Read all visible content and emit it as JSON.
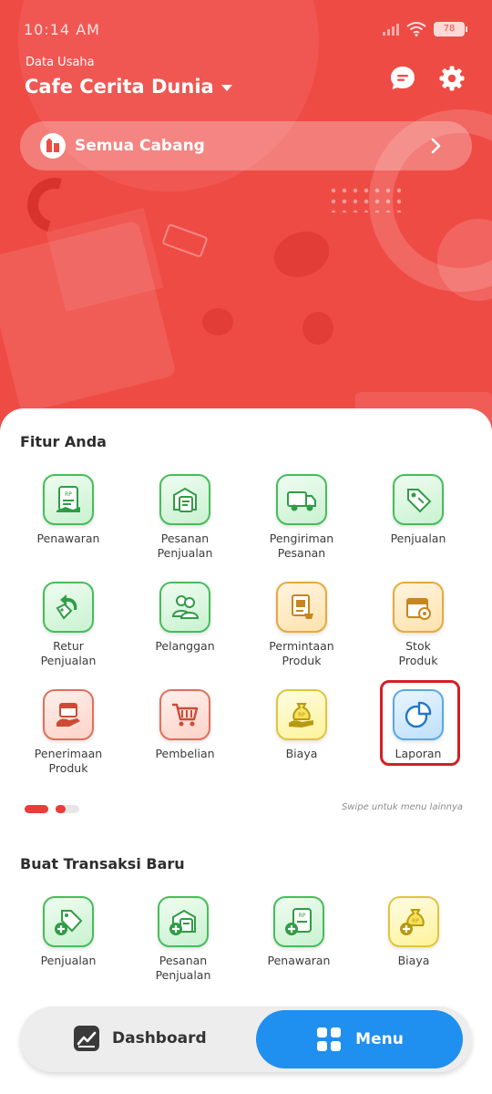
{
  "status_bar": {
    "time": "10:14 AM",
    "battery": "78"
  },
  "header": {
    "subtitle": "Data Usaha",
    "business_name": "Cafe Cerita Dunia",
    "branch_selector": "Semua Cabang"
  },
  "features": {
    "title": "Fitur Anda",
    "items": [
      {
        "label": "Penawaran",
        "icon": "quotation-icon",
        "color": "green"
      },
      {
        "label": "Pesanan\nPenjualan",
        "icon": "sales-order-icon",
        "color": "green"
      },
      {
        "label": "Pengiriman\nPesanan",
        "icon": "delivery-truck-icon",
        "color": "green"
      },
      {
        "label": "Penjualan",
        "icon": "price-tag-icon",
        "color": "green"
      },
      {
        "label": "Retur\nPenjualan",
        "icon": "return-tag-icon",
        "color": "green"
      },
      {
        "label": "Pelanggan",
        "icon": "customers-icon",
        "color": "green"
      },
      {
        "label": "Permintaan\nProduk",
        "icon": "product-request-icon",
        "color": "orange"
      },
      {
        "label": "Stok\nProduk",
        "icon": "stock-box-icon",
        "color": "orange"
      },
      {
        "label": "Penerimaan\nProduk",
        "icon": "receive-box-icon",
        "color": "red"
      },
      {
        "label": "Pembelian",
        "icon": "shopping-cart-icon",
        "color": "red"
      },
      {
        "label": "Biaya",
        "icon": "money-bag-icon",
        "color": "yellow"
      },
      {
        "label": "Laporan",
        "icon": "pie-chart-icon",
        "color": "blue"
      }
    ],
    "swipe_hint": "Swipe untuk menu lainnya"
  },
  "new_transaction": {
    "title": "Buat Transaksi Baru",
    "items": [
      {
        "label": "Penjualan",
        "icon": "add-sale-icon",
        "color": "green"
      },
      {
        "label": "Pesanan\nPenjualan",
        "icon": "add-sales-order-icon",
        "color": "green"
      },
      {
        "label": "Penawaran",
        "icon": "add-quotation-icon",
        "color": "green"
      },
      {
        "label": "Biaya",
        "icon": "add-expense-icon",
        "color": "yellow"
      }
    ]
  },
  "bottom_nav": {
    "dashboard": "Dashboard",
    "menu": "Menu"
  },
  "colors": {
    "brand_red": "#ef4b45",
    "active_blue": "#1f8ff0",
    "feature_green": "#46bd5a"
  }
}
